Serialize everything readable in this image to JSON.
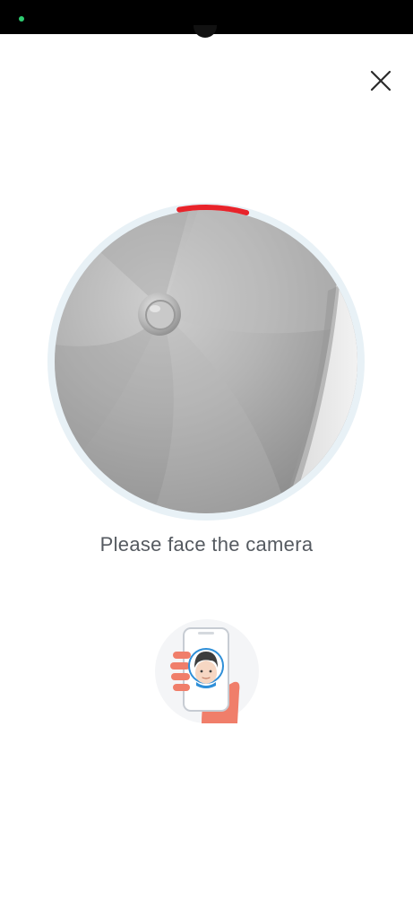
{
  "status_bar": {
    "indicator_color": "#2ecc71"
  },
  "header": {
    "close_icon": "close-icon"
  },
  "camera": {
    "ring_color": "#e8f1f6",
    "progress_color": "#e8232a",
    "progress_fraction": 0.07
  },
  "instruction": {
    "text": "Please face the camera",
    "color": "#555a60"
  },
  "illustration": {
    "icon": "face-scan-phone-icon"
  }
}
